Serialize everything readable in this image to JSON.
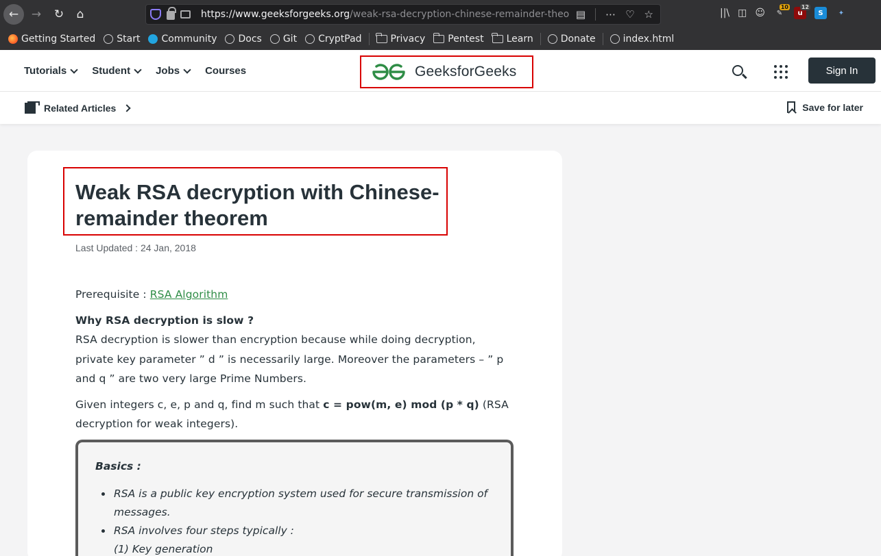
{
  "browser": {
    "url_host": "https://www.geeksforgeeks.org",
    "url_path": "/weak-rsa-decryption-chinese-remainder-theo",
    "bookmarks": [
      {
        "label": "Getting Started",
        "icon": "firefox-icon"
      },
      {
        "label": "Start",
        "icon": "globe-icon"
      },
      {
        "label": "Community",
        "icon": "community-icon"
      },
      {
        "label": "Docs",
        "icon": "globe-icon"
      },
      {
        "label": "Git",
        "icon": "globe-icon"
      },
      {
        "label": "CryptPad",
        "icon": "globe-icon"
      },
      {
        "label": "Privacy",
        "icon": "folder-icon"
      },
      {
        "label": "Pentest",
        "icon": "folder-icon"
      },
      {
        "label": "Learn",
        "icon": "folder-icon"
      },
      {
        "label": "Donate",
        "icon": "globe-icon"
      },
      {
        "label": "index.html",
        "icon": "globe-icon"
      }
    ],
    "ext_badges": {
      "badge1": "10",
      "badge2": "12"
    }
  },
  "header": {
    "menu": [
      {
        "label": "Tutorials",
        "has_dropdown": true
      },
      {
        "label": "Student",
        "has_dropdown": true
      },
      {
        "label": "Jobs",
        "has_dropdown": true
      },
      {
        "label": "Courses",
        "has_dropdown": false
      }
    ],
    "logo_text": "GeeksforGeeks",
    "signin_label": "Sign In"
  },
  "subbar": {
    "related_label": "Related Articles",
    "save_label": "Save for later"
  },
  "article": {
    "title": "Weak RSA decryption with Chinese-remainder theorem",
    "last_updated": "Last Updated : 24 Jan, 2018",
    "prereq_label": "Prerequisite : ",
    "prereq_link": "RSA Algorithm",
    "question": "Why RSA decryption is slow ?",
    "para1": "RSA decryption is slower than encryption because while doing decryption, private key parameter ” d ” is necessarily large. Moreover the parameters – ” p and q ” are two very large Prime Numbers.",
    "para2_a": "Given integers c, e, p and q, find m such that ",
    "para2_b": "c = pow(m, e) mod (p * q)",
    "para2_c": " (RSA decryption for weak integers).",
    "basics_title": "Basics :",
    "basics_items": [
      "RSA is a public key encryption system used for secure transmission of messages.",
      "RSA involves four steps typically :"
    ],
    "basics_step1": "(1) Key generation"
  },
  "colors": {
    "brand_green": "#2f8d46",
    "dark_text": "#273239",
    "highlight_red": "#d80000"
  }
}
